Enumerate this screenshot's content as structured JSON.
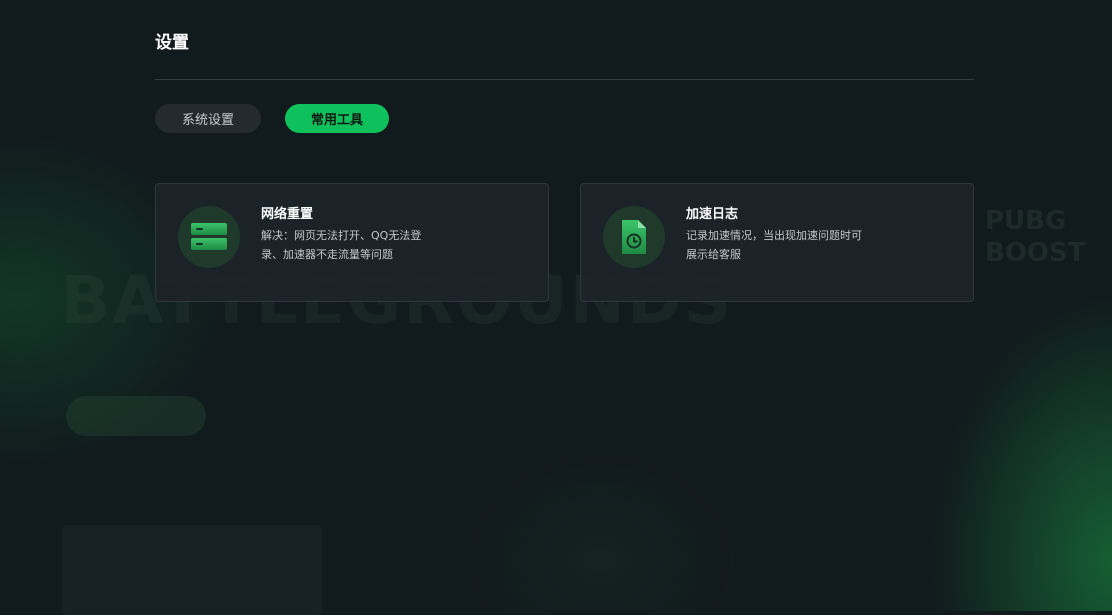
{
  "header": {
    "title": "设置"
  },
  "tabs": [
    {
      "label": "系统设置",
      "active": false
    },
    {
      "label": "常用工具",
      "active": true
    }
  ],
  "tools": [
    {
      "title": "网络重置",
      "description": "解决：网页无法打开、QQ无法登录、加速器不走流量等问题",
      "icon": "server-icon"
    },
    {
      "title": "加速日志",
      "description": "记录加速情况，当出现加速问题时可展示给客服",
      "icon": "log-file-icon"
    }
  ],
  "colors": {
    "accent": "#0fc15c",
    "background": "#111a1d",
    "card_background": "#1c2429",
    "icon_circle": "#1f3a2b"
  }
}
